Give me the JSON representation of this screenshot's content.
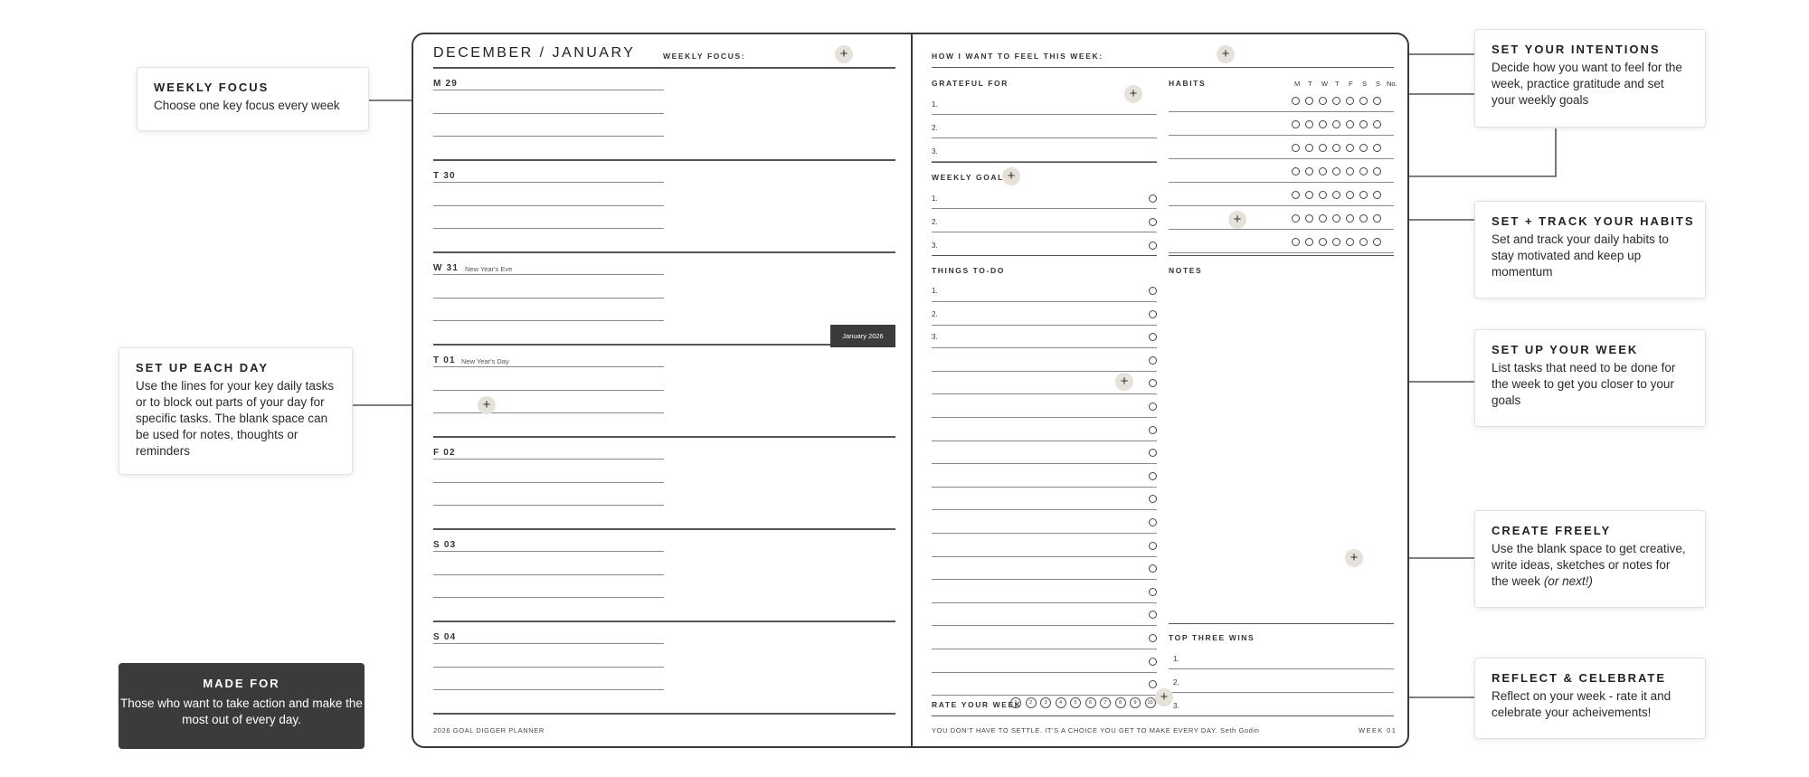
{
  "left_page": {
    "title": "DECEMBER / JANUARY",
    "weekly_focus_label": "WEEKLY FOCUS:",
    "days": [
      {
        "label": "M 29",
        "note": ""
      },
      {
        "label": "T 30",
        "note": ""
      },
      {
        "label": "W 31",
        "note": "New Year's Eve"
      },
      {
        "label": "T 01",
        "note": "New Year's Day"
      },
      {
        "label": "F 02",
        "note": ""
      },
      {
        "label": "S 03",
        "note": ""
      },
      {
        "label": "S 04",
        "note": ""
      }
    ],
    "month_tab": "January 2026",
    "footer": "2026 GOAL DIGGER PLANNER"
  },
  "right_page": {
    "feel_label": "HOW I WANT TO FEEL THIS WEEK:",
    "grateful_label": "GRATEFUL FOR",
    "grateful_items": [
      "1.",
      "2.",
      "3."
    ],
    "habits_label": "HABITS",
    "habit_days": [
      "M",
      "T",
      "W",
      "T",
      "F",
      "S",
      "S",
      "No."
    ],
    "goals_label": "WEEKLY GOALS",
    "goal_items": [
      "1.",
      "2.",
      "3."
    ],
    "todo_label": "THINGS TO-DO",
    "todo_items": [
      "1.",
      "2.",
      "3."
    ],
    "notes_label": "NOTES",
    "wins_label": "TOP THREE WINS",
    "win_items": [
      "1.",
      "2.",
      "3."
    ],
    "rate_label": "RATE YOUR WEEK",
    "rate_values": [
      "1",
      "2",
      "3",
      "4",
      "5",
      "6",
      "7",
      "8",
      "9",
      "10"
    ],
    "quote": "YOU DON'T HAVE TO SETTLE. IT'S A CHOICE YOU GET TO MAKE EVERY DAY. Seth Godin",
    "week": "WEEK 01"
  },
  "callouts": {
    "weekly_focus": {
      "title": "WEEKLY FOCUS",
      "text": "Choose one key focus every week"
    },
    "set_up_day": {
      "title": "SET UP EACH DAY",
      "text": "Use the lines for your key daily tasks or to block out parts of your day for specific tasks. The blank space can be used for notes, thoughts or reminders"
    },
    "intentions": {
      "title": "SET YOUR INTENTIONS",
      "text": "Decide how you want to feel for the week, practice gratitude and set your weekly goals"
    },
    "habits": {
      "title": "SET + TRACK YOUR HABITS",
      "text": "Set and track your daily habits to stay motivated and keep up momentum"
    },
    "set_up_week": {
      "title": "SET UP YOUR WEEK",
      "text": "List tasks that need to be done for the week to get you closer to your goals"
    },
    "create": {
      "title": "CREATE FREELY",
      "text": "Use the blank space to get creative, write ideas, sketches or notes for the week",
      "text_italic": "(or next!)"
    },
    "reflect": {
      "title": "REFLECT & CELEBRATE",
      "text": "Reflect on your week - rate it and celebrate your acheivements!"
    }
  },
  "made_for": {
    "title": "MADE FOR",
    "text": "Those who want to take action and make the most out of every day."
  },
  "colors": {
    "accent_plus": "#e6e2da",
    "dark_card": "#3b3b3b",
    "line": "#8a8a8a"
  }
}
